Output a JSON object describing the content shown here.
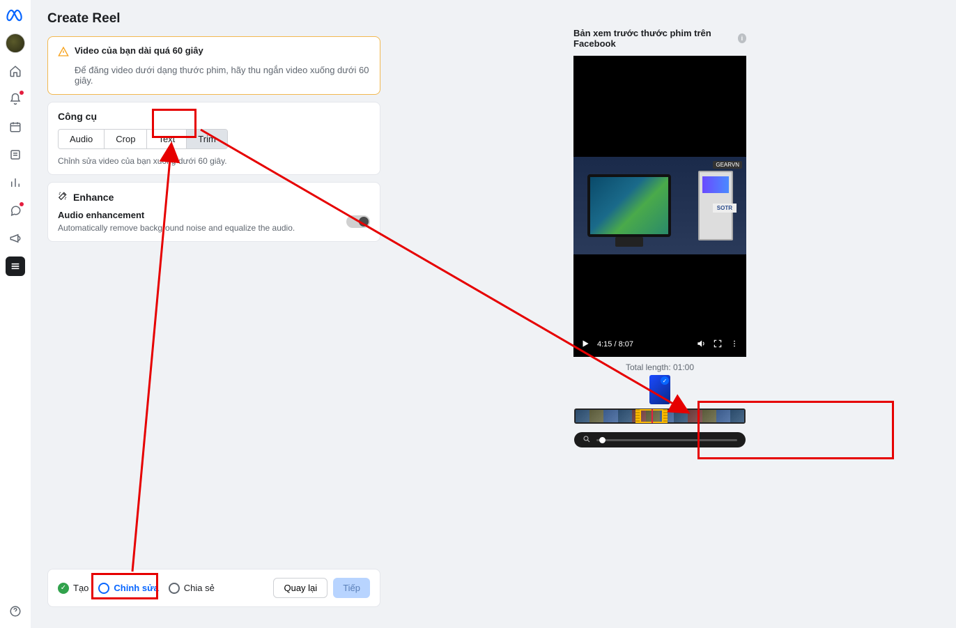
{
  "page": {
    "title": "Create Reel"
  },
  "warning": {
    "title": "Video của bạn dài quá 60 giây",
    "desc": "Để đăng video dưới dạng thước phim, hãy thu ngắn video xuống dưới 60 giây."
  },
  "tools": {
    "title": "Công cụ",
    "tabs": [
      "Audio",
      "Crop",
      "Text",
      "Trim"
    ],
    "active": "Trim",
    "desc": "Chỉnh sửa video của bạn xuống dưới 60 giây."
  },
  "enhance": {
    "title": "Enhance",
    "item_label": "Audio enhancement",
    "item_desc": "Automatically remove background noise and equalize the audio."
  },
  "footer": {
    "steps": [
      "Tạo",
      "Chỉnh sửa",
      "Chia sẻ"
    ],
    "back": "Quay lại",
    "next": "Tiếp"
  },
  "preview": {
    "header": "Bản xem trước thước phim trên Facebook",
    "gearvn": "GEARVN",
    "sotr": "SOTR",
    "time": "4:15 / 8:07",
    "total_length": "Total length: 01:00"
  }
}
